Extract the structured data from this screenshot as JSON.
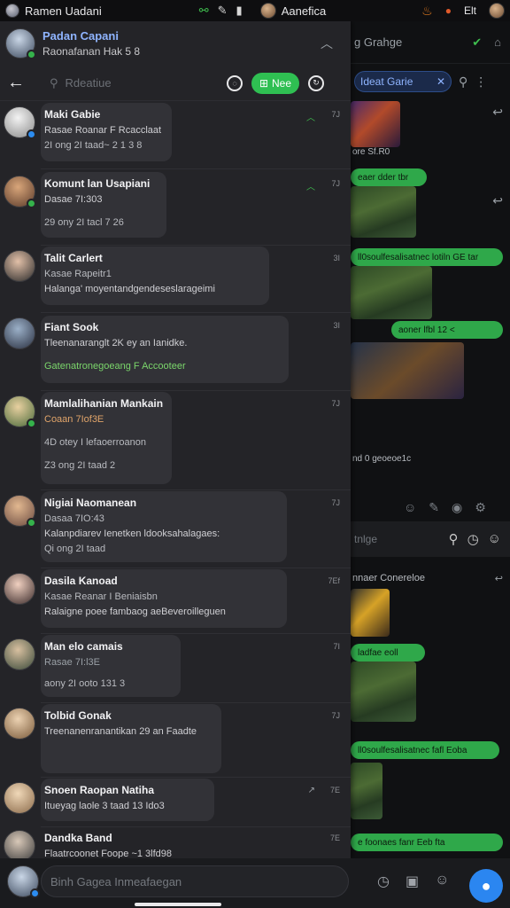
{
  "status_bar": {
    "title": "Ramen Uadani",
    "mid_label": "Aanefica",
    "right_label": "Elt"
  },
  "profile": {
    "name": "Padan Capani",
    "subtitle": "Raonafanan Hak 5 8"
  },
  "toolbar": {
    "search_placeholder": "Rdeatiue",
    "new_button_label": "Nee"
  },
  "right_pane": {
    "header": "g Grahge",
    "search_pill": "Ideat Garie",
    "captions": [
      "ore Sf.R0",
      "nnaer Conereloe",
      "nd 0 geoeoe1c"
    ],
    "green_bubbles": [
      "eaer dder tbr",
      "ll0soulfesalisatnec lotiln GE tar",
      "aoner lfbl 12 <",
      "ladfae eoll",
      "ll0soulfesalisatnec fafl Eoba",
      "e foonaes fanr Eeb fta"
    ],
    "input_placeholder": "tnlge",
    "fab_icon": "chat-bubble-icon"
  },
  "chats": [
    {
      "name": "Maki Gabie",
      "line1": "Rasae Roanar F Rcacclaat",
      "line2": "2I ong 2I taad~ 2 1 3 8",
      "time": "7J",
      "pinned": true
    },
    {
      "name": "Komunt lan Usapiani",
      "line1": "Dasae 7I:303",
      "line2": "29 ony 2I tacl 7 26",
      "time": "7J",
      "pinned": true
    },
    {
      "name": "Talit Carlert",
      "line1": "Kasae Rapeitr1",
      "line2": "Halanga' moyentandgendeseslarageimi",
      "time": "3I",
      "pinned": false
    },
    {
      "name": "Fiant Sook",
      "line1": "Tleenanaranglt 2K ey an Ianidke.",
      "line2": "Gatenatronegoeang F Accooteer",
      "time": "3I",
      "pinned": false,
      "green": true
    },
    {
      "name": "Mamlalihanian Mankain",
      "line1": "Coaan 7Iof3E",
      "line2": "4D otey I lefaoerroanon",
      "line3": "Z3 ong 2I taad 2",
      "time": "7J",
      "pinned": false
    },
    {
      "name": "Nigiai Naomanean",
      "line1": "Dasaa 7IO:43",
      "line2": "Kalanpdiarev Ienetken ldooksahalagaes:",
      "line3": "Qi ong 2I taad",
      "time": "7J",
      "pinned": false
    },
    {
      "name": "Dasila Kanoad",
      "line1": "Kasae Reanar I Beniaisbn",
      "line2": "Ralaigne poee fambaog aeBeveroilleguen",
      "time": "7Ef",
      "pinned": false
    },
    {
      "name": "Man elo camais",
      "line1": "Rasae 7I:l3E",
      "line2": "aony 2I ooto 131 3",
      "time": "7I",
      "pinned": false
    },
    {
      "name": "Tolbid Gonak",
      "line1": "Treenanenranantikan 29 an Faadte",
      "line2": "",
      "time": "7J",
      "pinned": false
    },
    {
      "name": "Snoen Raopan Natiha",
      "line1": "Itueyag laole 3 taad 13 Ido3",
      "line2": "",
      "time": "7E",
      "pinned": true,
      "pin_grey": true
    },
    {
      "name": "Dandka Band",
      "line1": "Flaatrcoonet Foope ~1 3lfd98",
      "line2": "",
      "time": "7E",
      "pinned": false
    }
  ],
  "composer": {
    "placeholder": "Binh Gagea Inmeafaegan"
  }
}
